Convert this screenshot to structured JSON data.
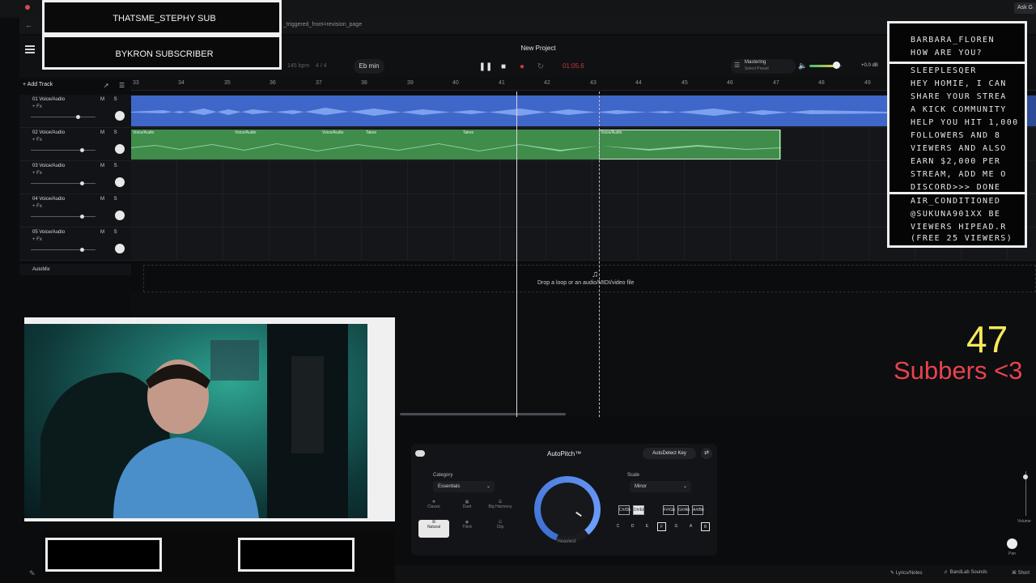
{
  "browser": {
    "url_fragment": "_triggered_from=revision_page",
    "ask_button": "Ask G"
  },
  "toolbar": {
    "project_title": "New Project",
    "bpm": "145 bpm",
    "time_signature": "4 / 4",
    "key": "Eb min",
    "time": "01:05.6",
    "mastering_title": "Mastering",
    "mastering_sub": "Select Preset",
    "volume_db": "+0.0 dB"
  },
  "tracks_panel": {
    "add_track": "+ Add Track",
    "ruler": [
      "33",
      "34",
      "35",
      "36",
      "37",
      "38",
      "39",
      "40",
      "41",
      "42",
      "43",
      "44",
      "45",
      "46",
      "47",
      "48",
      "49"
    ],
    "tracks": [
      {
        "name": "01 Voice/Audio",
        "fx": "+ Fx"
      },
      {
        "name": "02 Voice/Audio",
        "fx": "+ Fx"
      },
      {
        "name": "03 Voice/Audio",
        "fx": "+ Fx"
      },
      {
        "name": "04 Voice/Audio",
        "fx": "+ Fx"
      },
      {
        "name": "05 Voice/Audio",
        "fx": "+ Fx"
      }
    ],
    "ms_label": "M S",
    "clip_labels": [
      "Voice/Audio",
      "Takes",
      "Voice/Audio"
    ],
    "automix": "AutoMix",
    "drop_text": "Drop a loop or an audio/MIDI/video file"
  },
  "overlay": {
    "sub_1": "THATSME_STEPHY SUB",
    "sub_2": "BYKRON SUBSCRIBER",
    "chat": [
      "BARBARA_FLOREN",
      "HOW ARE YOU?",
      "SLEEPLESQER",
      "HEY HOMIE, I CAN",
      "SHARE YOUR STREA",
      "A KICK COMMUNITY",
      "HELP YOU HIT 1,000",
      "FOLLOWERS AND 8",
      "VIEWERS AND ALSO",
      "EARN $2,000 PER",
      "STREAM, ADD ME O",
      "DISCORD>>> DONE",
      "AIR_CONDITIONED",
      "@SUKUNA901XX BE",
      "VIEWERS HIPEAD.R",
      "(FREE 25 VIEWERS)"
    ],
    "sub_count": "47",
    "sub_goal": "Subbers <3"
  },
  "autopitch": {
    "title": "AutoPitch™",
    "autodetect": "AutoDetect Key",
    "category_label": "Category",
    "category_value": "Essentials",
    "styles": [
      "Classic",
      "Duet",
      "Big Harmony",
      "Natural",
      "Third",
      "Clip"
    ],
    "dial_label": "Heaviest",
    "scale_label": "Scale",
    "scale_value": "Minor",
    "keys_top": [
      "C#/Db",
      "D#/Eb",
      "F#/Gb",
      "G#/Ab",
      "A#/Bb"
    ],
    "notes": [
      "C",
      "D",
      "E",
      "F",
      "G",
      "A",
      "B"
    ]
  },
  "bottom_bar": {
    "lyrics": "Lyrics/Notes",
    "sounds": "BandLab Sounds",
    "shortcuts": "Short",
    "volume": "Volume",
    "pan": "Pan"
  }
}
